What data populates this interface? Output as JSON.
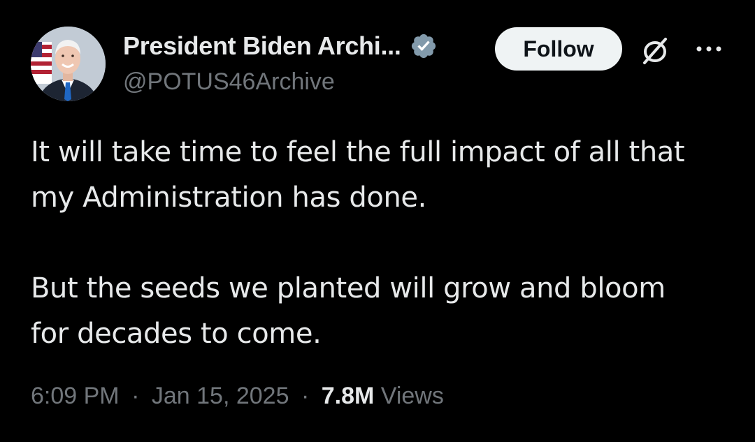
{
  "author": {
    "display_name": "President Biden Archi...",
    "handle": "@POTUS46Archive",
    "verified_icon": "verified-badge-icon",
    "avatar_icon": "profile-photo"
  },
  "actions": {
    "follow_label": "Follow",
    "grok_icon": "grok-icon",
    "more_icon": "more-options-icon"
  },
  "tweet": {
    "paragraphs": [
      "It will take time to feel the full impact of all that\nmy Administration has done.",
      "But the seeds we planted will grow and bloom\nfor decades to come."
    ]
  },
  "meta": {
    "time": "6:09 PM",
    "separator": "·",
    "date": "Jan 15, 2025",
    "views_count": "7.8M",
    "views_label": "Views"
  },
  "colors": {
    "background": "#000000",
    "text_primary": "#e7e9ea",
    "text_secondary": "#71767b",
    "follow_bg": "#eff3f4",
    "verified_badge": "#829aab"
  }
}
